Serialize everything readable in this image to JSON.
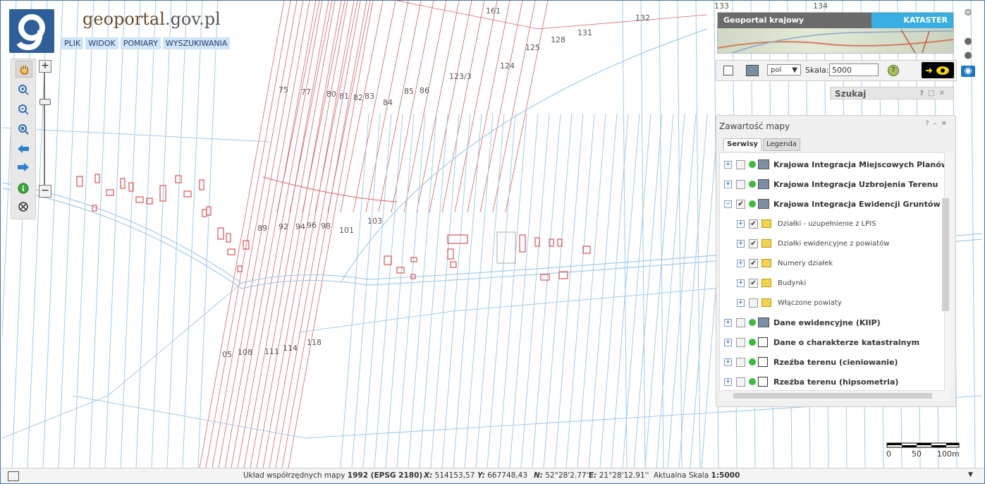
{
  "logo": {
    "text_prefix": "geoportal",
    "text_suffix": ".gov.pl"
  },
  "menu": [
    "PLIK",
    "WIDOK",
    "POMIARY",
    "WYSZUKIWANIA"
  ],
  "thumb": {
    "left_title": "Geoportal krajowy",
    "right_title": "KATASTER"
  },
  "controls": {
    "lang": "pol",
    "scale_label": "Skala:",
    "scale_value": "5000"
  },
  "search_panel": {
    "title": "Szukaj"
  },
  "contents_panel": {
    "title": "Zawartość mapy",
    "tabs": [
      "Serwisy",
      "Legenda"
    ],
    "rows": [
      {
        "label": "Krajowa Integracja Miejscowych Planów Z",
        "exp": "+",
        "checked": false,
        "icon": "wms",
        "bold": true
      },
      {
        "label": "Krajowa Integracja Uzbrojenia Terenu",
        "exp": "+",
        "checked": false,
        "icon": "wms",
        "bold": true
      },
      {
        "label": "Krajowa Integracja Ewidencji Gruntów",
        "exp": "−",
        "checked": true,
        "icon": "wms",
        "bold": true
      },
      {
        "label": "Działki - uzupełnienie z LPIS",
        "exp": "+",
        "checked": true,
        "icon": "folder",
        "bold": false
      },
      {
        "label": "Działki ewidencyjne z powiatów",
        "exp": "+",
        "checked": true,
        "icon": "folder",
        "bold": false
      },
      {
        "label": "Numery działek",
        "exp": "+",
        "checked": true,
        "icon": "folder",
        "bold": false
      },
      {
        "label": "Budynki",
        "exp": "+",
        "checked": true,
        "icon": "folder",
        "bold": false
      },
      {
        "label": "Włączone powiaty",
        "exp": "+",
        "checked": false,
        "icon": "folder",
        "bold": false
      },
      {
        "label": "Dane ewidencyjne (KIIP)",
        "exp": "+",
        "checked": false,
        "icon": "wms",
        "bold": true
      },
      {
        "label": "Dane o charakterze katastralnym",
        "exp": "+",
        "checked": false,
        "icon": "service",
        "bold": true
      },
      {
        "label": "Rzeźba terenu (cieniowanie)",
        "exp": "+",
        "checked": false,
        "icon": "service",
        "bold": true
      },
      {
        "label": "Rzeźba terenu (hipsometria)",
        "exp": "+",
        "checked": false,
        "icon": "service",
        "bold": true
      }
    ]
  },
  "parcel_labels": [
    "161",
    "133",
    "134",
    "132",
    "131",
    "128",
    "125",
    "124",
    "123/3",
    "75",
    "77",
    "80",
    "81",
    "82",
    "83",
    "84",
    "85",
    "86",
    "89",
    "92",
    "94",
    "96",
    "98",
    "101",
    "103",
    "05",
    "108",
    "111",
    "114",
    "118"
  ],
  "scalebar": {
    "ticks": [
      "0",
      "50",
      "100m"
    ]
  },
  "status": {
    "crs_prefix": "Układ współrzędnych mapy",
    "crs_value": "1992 (EPSG 2180)",
    "x_label": "X:",
    "x_value": "514153,57",
    "y_label": "Y:",
    "y_value": "667748,43",
    "n_label": "N:",
    "n_value": "52°28'2.77''",
    "e_label": "E:",
    "e_value": "21°28'12.91''",
    "scale_label": "Aktualna Skala",
    "scale_value": "1:5000"
  },
  "colors": {
    "parcel_line": "#9ecbf0",
    "cadastral_red": "#e06060",
    "building": "#e05050",
    "panel_bg": "#f0f0f0",
    "accent_blue": "#39aee3"
  },
  "icons": [
    "hand-icon",
    "zoom-in-icon",
    "zoom-out-icon",
    "zoom-extent-icon",
    "back-arrow-icon",
    "forward-arrow-icon",
    "info-icon",
    "measure-icon",
    "gear-icon",
    "eye-icon",
    "legend-icon",
    "wms-icon"
  ]
}
